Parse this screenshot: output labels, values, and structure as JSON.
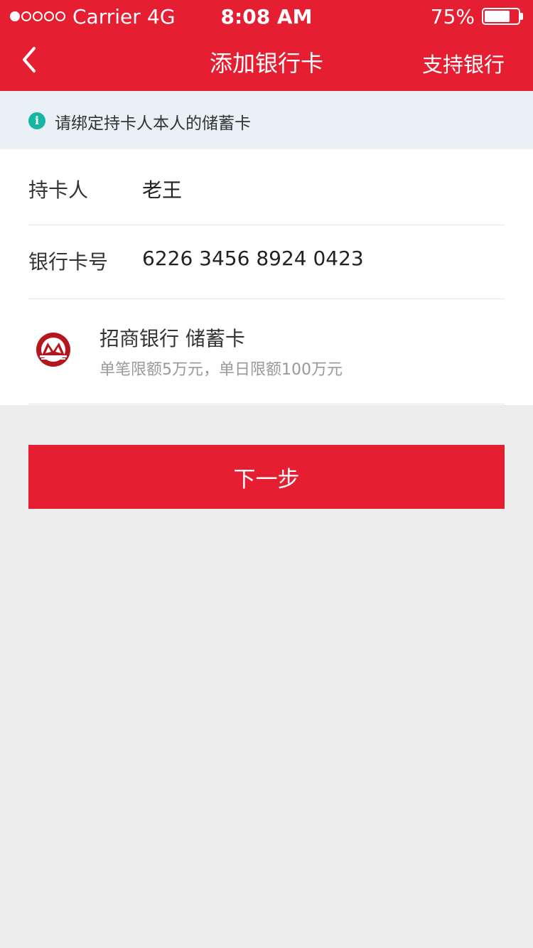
{
  "status_bar": {
    "carrier": "Carrier",
    "network": "4G",
    "time": "8:08 AM",
    "battery": "75%",
    "battery_level": 0.75,
    "signal_bars_filled": 1,
    "signal_bars_total": 5
  },
  "nav": {
    "title": "添加银行卡",
    "right_action": "支持银行"
  },
  "notice": {
    "icon": "info-icon",
    "text": "请绑定持卡人本人的储蓄卡"
  },
  "form": {
    "holder_label": "持卡人",
    "holder_value": "老王",
    "card_label": "银行卡号",
    "card_value": "6226 3456 8924 0423"
  },
  "bank": {
    "logo": "cmb-logo-icon",
    "name": "招商银行  储蓄卡",
    "limit": "单笔限额5万元，单日限额100万元"
  },
  "button": {
    "next_label": "下一步"
  },
  "colors": {
    "brand_red": "#e61e32",
    "info_teal": "#17b6a2",
    "notice_bg": "#e9f1f7",
    "page_bg": "#ededed"
  }
}
